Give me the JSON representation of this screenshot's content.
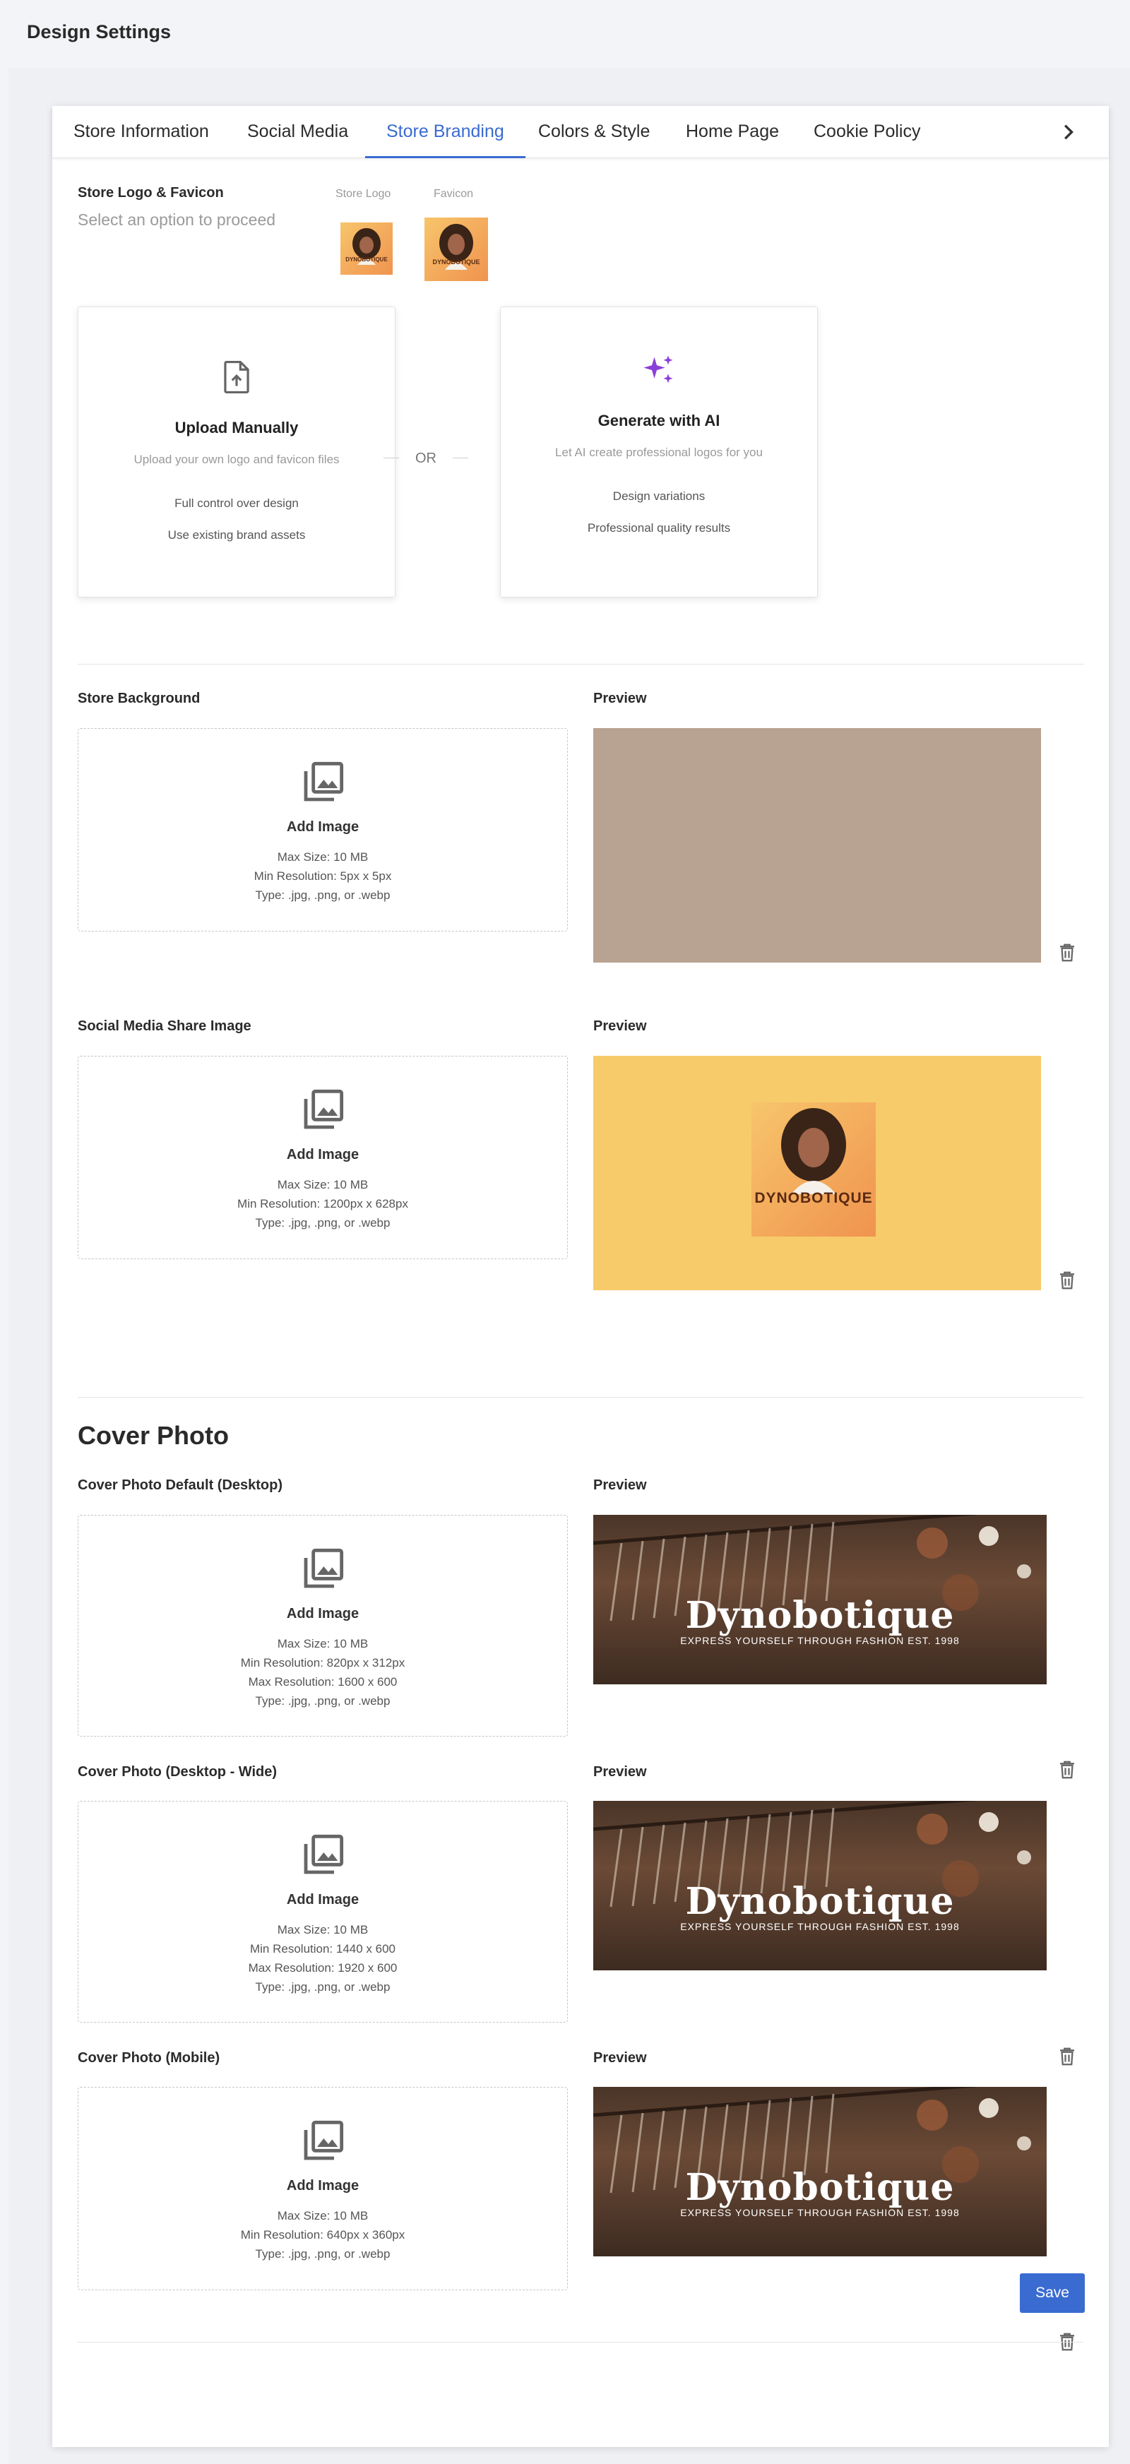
{
  "page": {
    "title": "Design Settings"
  },
  "tabs": [
    {
      "label": "Store Information"
    },
    {
      "label": "Social Media"
    },
    {
      "label": "Store Branding",
      "active": true
    },
    {
      "label": "Colors & Style"
    },
    {
      "label": "Home Page"
    },
    {
      "label": "Cookie Policy"
    }
  ],
  "logo_section": {
    "title": "Store Logo & Favicon",
    "hint": "Select an option to proceed",
    "store_logo_label": "Store Logo",
    "favicon_label": "Favicon",
    "brand_text": "DYNOBOTIQUE",
    "or_text": "OR",
    "manual": {
      "title": "Upload Manually",
      "desc": "Upload your own logo and favicon files",
      "features": [
        "Full control over design",
        "Use existing brand assets"
      ]
    },
    "ai": {
      "title": "Generate with AI",
      "desc": "Let AI create professional logos for you",
      "features": [
        "Design variations",
        "Professional quality results"
      ]
    }
  },
  "store_background": {
    "label": "Store Background",
    "preview_label": "Preview",
    "add_label": "Add Image",
    "specs": [
      "Max Size: 10 MB",
      "Min Resolution: 5px x 5px",
      "Type: .jpg, .png, or .webp"
    ],
    "preview_color": "#b8a291"
  },
  "social_share": {
    "label": "Social Media Share Image",
    "preview_label": "Preview",
    "add_label": "Add Image",
    "specs": [
      "Max Size: 10 MB",
      "Min Resolution: 1200px x 628px",
      "Type: .jpg, .png, or .webp"
    ],
    "preview_bg": "#f7cb6a",
    "brand_text": "DYNOBOTIQUE"
  },
  "cover_photo": {
    "heading": "Cover Photo",
    "brand_title": "Dynobotique",
    "brand_sub": "EXPRESS YOURSELF THROUGH FASHION EST. 1998",
    "desktop": {
      "label": "Cover Photo Default (Desktop)",
      "preview_label": "Preview",
      "add_label": "Add Image",
      "specs": [
        "Max Size: 10 MB",
        "Min Resolution: 820px x 312px",
        "Max Resolution: 1600 x 600",
        "Type: .jpg, .png, or .webp"
      ]
    },
    "wide": {
      "label": "Cover Photo (Desktop - Wide)",
      "preview_label": "Preview",
      "add_label": "Add Image",
      "specs": [
        "Max Size: 10 MB",
        "Min Resolution: 1440 x 600",
        "Max Resolution: 1920 x 600",
        "Type: .jpg, .png, or .webp"
      ]
    },
    "mobile": {
      "label": "Cover Photo (Mobile)",
      "preview_label": "Preview",
      "add_label": "Add Image",
      "specs": [
        "Max Size: 10 MB",
        "Min Resolution: 640px x 360px",
        "Type: .jpg, .png, or .webp"
      ]
    }
  },
  "actions": {
    "save_label": "Save"
  },
  "colors": {
    "accent": "#3a6bd1",
    "ai_icon": "#8a3fd9"
  }
}
